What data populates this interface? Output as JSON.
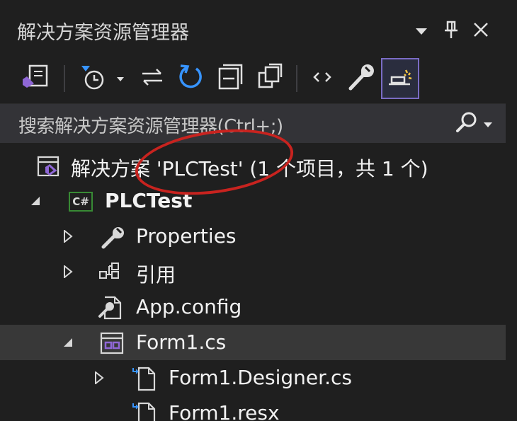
{
  "panel": {
    "title": "解决方案资源管理器",
    "pin_icon": "pin-icon",
    "close_icon": "close-icon",
    "menu_icon": "chevron-down-icon"
  },
  "toolbar": {
    "buttons": [
      "vs-solution-icon",
      "pending-changes-icon",
      "sync-icon",
      "refresh-icon",
      "collapse-all-icon",
      "show-all-files-icon",
      "code-view-icon",
      "properties-wrench-icon",
      "preview-selected-icon"
    ]
  },
  "search": {
    "placeholder": "搜索解决方案资源管理器(Ctrl+;)"
  },
  "tree": {
    "solution": "解决方案 'PLCTest' (1 个项目，共 1 个)",
    "project": "PLCTest",
    "project_badge": "C#",
    "items": {
      "properties": "Properties",
      "references": "引用",
      "app_config": "App.config",
      "form1": "Form1.cs",
      "form1_designer": "Form1.Designer.cs",
      "form1_resx": "Form1.resx"
    }
  },
  "colors": {
    "background": "#1f1f1f",
    "search_bg": "#333337",
    "selection": "#383838",
    "accent_blue": "#3794ff",
    "vs_purple": "#8f67d6",
    "annotation_red": "#c8231f"
  }
}
